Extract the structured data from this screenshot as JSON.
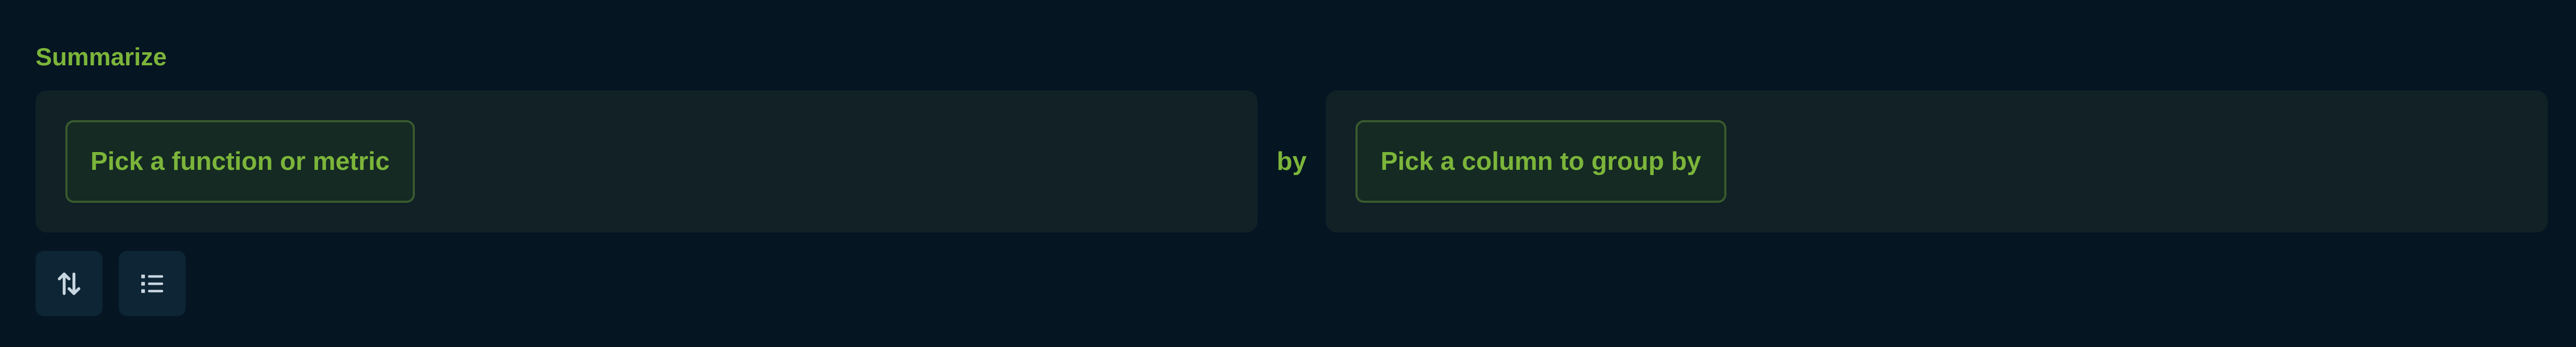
{
  "summarize": {
    "label": "Summarize",
    "metric_placeholder": "Pick a function or metric",
    "by_label": "by",
    "group_placeholder": "Pick a column to group by"
  },
  "actions": [
    {
      "icon": "sort-arrows-icon"
    },
    {
      "icon": "list-icon"
    }
  ],
  "colors": {
    "background": "#051522",
    "panel": "#112126",
    "accent": "#7cb53a",
    "pill_border": "#3a5a2e",
    "button_bg": "#0d2535",
    "icon": "#c8d6e0"
  }
}
